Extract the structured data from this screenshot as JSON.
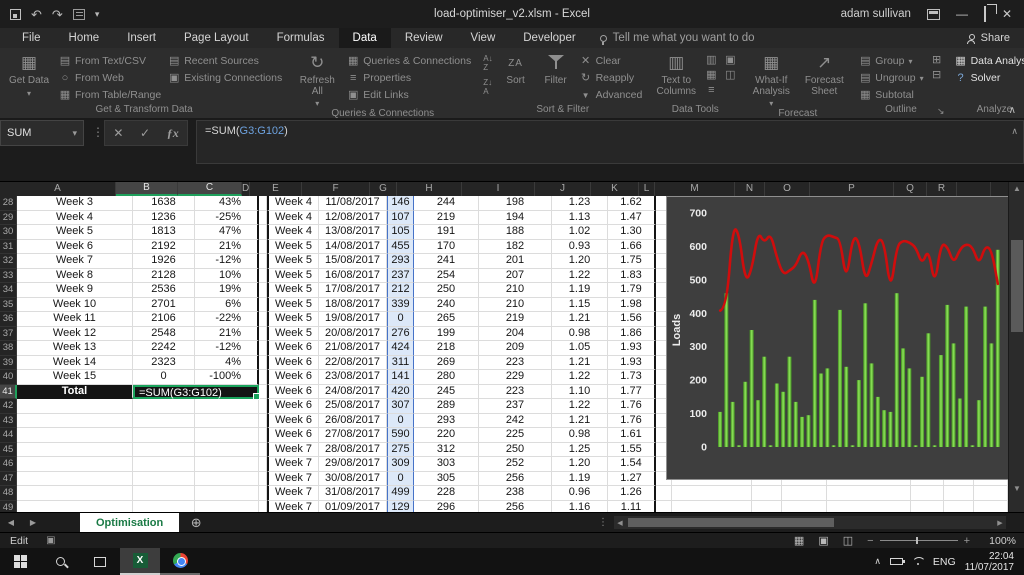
{
  "titlebar": {
    "title": "load-optimiser_v2.xlsm  -  Excel",
    "user": "adam sullivan"
  },
  "tabs": [
    "File",
    "Home",
    "Insert",
    "Page Layout",
    "Formulas",
    "Data",
    "Review",
    "View",
    "Developer"
  ],
  "active_tab": "Data",
  "tellme": "Tell me what you want to do",
  "share_label": "Share",
  "ribbon": {
    "get_transform": {
      "label": "Get & Transform Data",
      "get_data": "Get Data",
      "col1": [
        "From Text/CSV",
        "From Web",
        "From Table/Range"
      ],
      "col2": [
        "Recent Sources",
        "Existing Connections"
      ]
    },
    "queries": {
      "label": "Queries & Connections",
      "refresh_all": "Refresh All",
      "items": [
        "Queries & Connections",
        "Properties",
        "Edit Links"
      ]
    },
    "sort_filter": {
      "label": "Sort & Filter",
      "sort": "Sort",
      "filter": "Filter",
      "items": [
        "Clear",
        "Reapply",
        "Advanced"
      ]
    },
    "data_tools": {
      "label": "Data Tools",
      "text_to_columns": "Text to Columns"
    },
    "forecast": {
      "label": "Forecast",
      "whatif": "What-If Analysis",
      "forecast_sheet": "Forecast Sheet"
    },
    "outline": {
      "label": "Outline",
      "items": [
        "Group",
        "Ungroup",
        "Subtotal"
      ]
    },
    "analyze": {
      "label": "Analyze",
      "items": [
        "Data Analysis",
        "Solver"
      ]
    }
  },
  "formula_bar": {
    "name_box": "SUM",
    "pre": "=SUM(",
    "ref": "G3:G102",
    "post": ")"
  },
  "grid": {
    "visible_columns": [
      "A",
      "B",
      "C",
      "D",
      "E",
      "F",
      "G",
      "H",
      "I",
      "J",
      "K",
      "L",
      "M",
      "N",
      "O",
      "P",
      "Q",
      "R"
    ],
    "selected_columns": [
      "B",
      "C"
    ],
    "highlight_column": "G",
    "active_row": 41,
    "rows": [
      {
        "n": 28,
        "a": "Week 3",
        "b": "1638",
        "c": "43%",
        "e": "Week 4",
        "f": "11/08/2017",
        "g": "146",
        "h": "244",
        "i": "198",
        "j": "1.23",
        "k": "1.62"
      },
      {
        "n": 29,
        "a": "Week 4",
        "b": "1236",
        "c": "-25%",
        "e": "Week 4",
        "f": "12/08/2017",
        "g": "107",
        "h": "219",
        "i": "194",
        "j": "1.13",
        "k": "1.47"
      },
      {
        "n": 30,
        "a": "Week 5",
        "b": "1813",
        "c": "47%",
        "e": "Week 4",
        "f": "13/08/2017",
        "g": "105",
        "h": "191",
        "i": "188",
        "j": "1.02",
        "k": "1.30"
      },
      {
        "n": 31,
        "a": "Week 6",
        "b": "2192",
        "c": "21%",
        "e": "Week 5",
        "f": "14/08/2017",
        "g": "455",
        "h": "170",
        "i": "182",
        "j": "0.93",
        "k": "1.66"
      },
      {
        "n": 32,
        "a": "Week 7",
        "b": "1926",
        "c": "-12%",
        "e": "Week 5",
        "f": "15/08/2017",
        "g": "293",
        "h": "241",
        "i": "201",
        "j": "1.20",
        "k": "1.75"
      },
      {
        "n": 33,
        "a": "Week 8",
        "b": "2128",
        "c": "10%",
        "e": "Week 5",
        "f": "16/08/2017",
        "g": "237",
        "h": "254",
        "i": "207",
        "j": "1.22",
        "k": "1.83"
      },
      {
        "n": 34,
        "a": "Week 9",
        "b": "2536",
        "c": "19%",
        "e": "Week 5",
        "f": "17/08/2017",
        "g": "212",
        "h": "250",
        "i": "210",
        "j": "1.19",
        "k": "1.79"
      },
      {
        "n": 35,
        "a": "Week 10",
        "b": "2701",
        "c": "6%",
        "e": "Week 5",
        "f": "18/08/2017",
        "g": "339",
        "h": "240",
        "i": "210",
        "j": "1.15",
        "k": "1.98"
      },
      {
        "n": 36,
        "a": "Week 11",
        "b": "2106",
        "c": "-22%",
        "e": "Week 5",
        "f": "19/08/2017",
        "g": "0",
        "h": "265",
        "i": "219",
        "j": "1.21",
        "k": "1.56"
      },
      {
        "n": 37,
        "a": "Week 12",
        "b": "2548",
        "c": "21%",
        "e": "Week 5",
        "f": "20/08/2017",
        "g": "276",
        "h": "199",
        "i": "204",
        "j": "0.98",
        "k": "1.86"
      },
      {
        "n": 38,
        "a": "Week 13",
        "b": "2242",
        "c": "-12%",
        "e": "Week 6",
        "f": "21/08/2017",
        "g": "424",
        "h": "218",
        "i": "209",
        "j": "1.05",
        "k": "1.93"
      },
      {
        "n": 39,
        "a": "Week 14",
        "b": "2323",
        "c": "4%",
        "e": "Week 6",
        "f": "22/08/2017",
        "g": "311",
        "h": "269",
        "i": "223",
        "j": "1.21",
        "k": "1.93"
      },
      {
        "n": 40,
        "a": "Week 15",
        "b": "0",
        "c": "-100%",
        "e": "Week 6",
        "f": "23/08/2017",
        "g": "141",
        "h": "280",
        "i": "229",
        "j": "1.22",
        "k": "1.73"
      },
      {
        "n": 41,
        "a": "Total",
        "b": "=SUM(G3:G102)",
        "c": "",
        "e": "Week 6",
        "f": "24/08/2017",
        "g": "420",
        "h": "245",
        "i": "223",
        "j": "1.10",
        "k": "1.77",
        "total": true
      },
      {
        "n": 42,
        "a": "",
        "b": "",
        "c": "",
        "e": "Week 6",
        "f": "25/08/2017",
        "g": "307",
        "h": "289",
        "i": "237",
        "j": "1.22",
        "k": "1.76"
      },
      {
        "n": 43,
        "a": "",
        "b": "",
        "c": "",
        "e": "Week 6",
        "f": "26/08/2017",
        "g": "0",
        "h": "293",
        "i": "242",
        "j": "1.21",
        "k": "1.76"
      },
      {
        "n": 44,
        "a": "",
        "b": "",
        "c": "",
        "e": "Week 6",
        "f": "27/08/2017",
        "g": "590",
        "h": "220",
        "i": "225",
        "j": "0.98",
        "k": "1.61"
      },
      {
        "n": 45,
        "a": "",
        "b": "",
        "c": "",
        "e": "Week 7",
        "f": "28/08/2017",
        "g": "275",
        "h": "312",
        "i": "250",
        "j": "1.25",
        "k": "1.55"
      },
      {
        "n": 46,
        "a": "",
        "b": "",
        "c": "",
        "e": "Week 7",
        "f": "29/08/2017",
        "g": "309",
        "h": "303",
        "i": "252",
        "j": "1.20",
        "k": "1.54"
      },
      {
        "n": 47,
        "a": "",
        "b": "",
        "c": "",
        "e": "Week 7",
        "f": "30/08/2017",
        "g": "0",
        "h": "305",
        "i": "256",
        "j": "1.19",
        "k": "1.27"
      },
      {
        "n": 48,
        "a": "",
        "b": "",
        "c": "",
        "e": "Week 7",
        "f": "31/08/2017",
        "g": "499",
        "h": "228",
        "i": "238",
        "j": "0.96",
        "k": "1.26"
      },
      {
        "n": 49,
        "a": "",
        "b": "",
        "c": "",
        "e": "Week 7",
        "f": "01/09/2017",
        "g": "129",
        "h": "296",
        "i": "256",
        "j": "1.16",
        "k": "1.11"
      }
    ]
  },
  "chart_data": {
    "type": "bar",
    "title": "",
    "xlabel": "",
    "ylabel": "Loads",
    "ylim": [
      0,
      700
    ],
    "yticks": [
      0,
      100,
      200,
      300,
      400,
      500,
      600,
      700
    ],
    "grid": false,
    "legend": false,
    "plot_bg": "#3e3e3e",
    "series": [
      {
        "id": "bars",
        "type": "bar",
        "color_dark": "#3f8a1f",
        "color_light": "#8fe65a",
        "values": [
          105,
          460,
          135,
          5,
          195,
          350,
          140,
          270,
          5,
          190,
          165,
          270,
          135,
          90,
          95,
          440,
          220,
          235,
          5,
          410,
          240,
          5,
          200,
          430,
          250,
          150,
          110,
          105,
          460,
          295,
          235,
          5,
          210,
          340,
          5,
          275,
          425,
          310,
          145,
          420,
          5,
          140,
          420,
          310,
          590
        ]
      },
      {
        "id": "line",
        "type": "line",
        "color": "#cf0d0d",
        "values": [
          408,
          415,
          660,
          640,
          492,
          530,
          645,
          610,
          640,
          565,
          515,
          528,
          542,
          590,
          560,
          462,
          615,
          635,
          628,
          622,
          492,
          630,
          618,
          492,
          550,
          625,
          612,
          462,
          602,
          618,
          612,
          598,
          545,
          595,
          480,
          610,
          600,
          548,
          592,
          608,
          598,
          545,
          602,
          590,
          488
        ]
      }
    ]
  },
  "sheet_bar": {
    "active_tab": "Optimisation"
  },
  "status_bar": {
    "mode": "Edit",
    "zoom": "100%"
  },
  "tray": {
    "lang": "ENG",
    "time": "22:04",
    "date": "11/07/2017"
  }
}
